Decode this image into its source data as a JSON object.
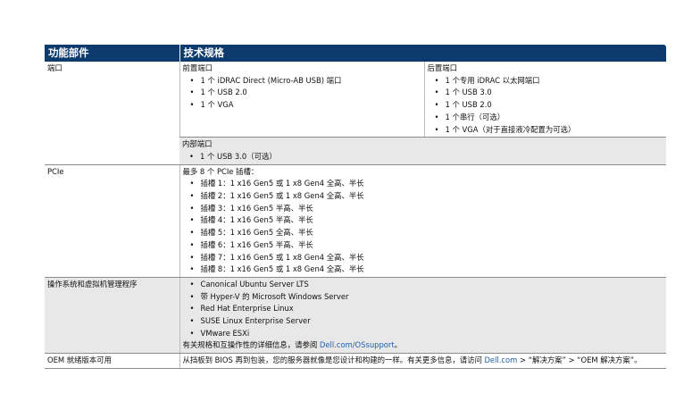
{
  "header": {
    "feature": "功能部件",
    "spec": "技术规格"
  },
  "ports": {
    "label": "端口",
    "front": {
      "title": "前置端口",
      "items": [
        "1 个 iDRAC Direct (Micro-AB USB) 端口",
        "1 个 USB 2.0",
        "1 个 VGA"
      ]
    },
    "rear": {
      "title": "后置端口",
      "items": [
        "1 个专用 iDRAC 以太网端口",
        "1 个 USB 3.0",
        "1 个 USB 2.0",
        "1 个串行（可选）",
        "1 个 VGA（对于直接液冷配置为可选）"
      ]
    },
    "internal": {
      "title": "内部端口",
      "items": [
        "1 个 USB 3.0（可选）"
      ]
    }
  },
  "pcie": {
    "label": "PCIe",
    "intro": "最多 8 个 PCIe 插槽：",
    "items": [
      "插槽 1：1 x16 Gen5 或 1 x8 Gen4 全高、半长",
      "插槽 2：1 x16 Gen5 或 1 x8 Gen4 全高、半长",
      "插槽 3：1 x16 Gen5 半高、半长",
      "插槽 4：1 x16 Gen5 半高、半长",
      "插槽 5：1 x16 Gen5 全高、半长",
      "插槽 6：1 x16 Gen5 半高、半长",
      "插槽 7：1 x16 Gen5 或 1 x8 Gen4 全高、半长",
      "插槽 8：1 x16 Gen5 或 1 x8 Gen4 全高、半长"
    ]
  },
  "os": {
    "label": "操作系统和虚拟机管理程序",
    "items": [
      "Canonical Ubuntu Server LTS",
      "带 Hyper-V 的 Microsoft Windows Server",
      "Red Hat Enterprise Linux",
      "SUSE Linux Enterprise Server",
      "VMware ESXi"
    ],
    "note_prefix": "有关规格和互操作性的详细信息，请参阅 ",
    "note_link": "Dell.com/OSsupport",
    "note_suffix": "。"
  },
  "oem": {
    "label": "OEM 就绪版本可用",
    "text_prefix": "从挡板到 BIOS 再到包装，您的服务器就像是您设计和构建的一样。有关更多信息，请访问 ",
    "text_link": "Dell.com",
    "text_suffix": " > “解决方案” > “OEM 解决方案”。"
  }
}
